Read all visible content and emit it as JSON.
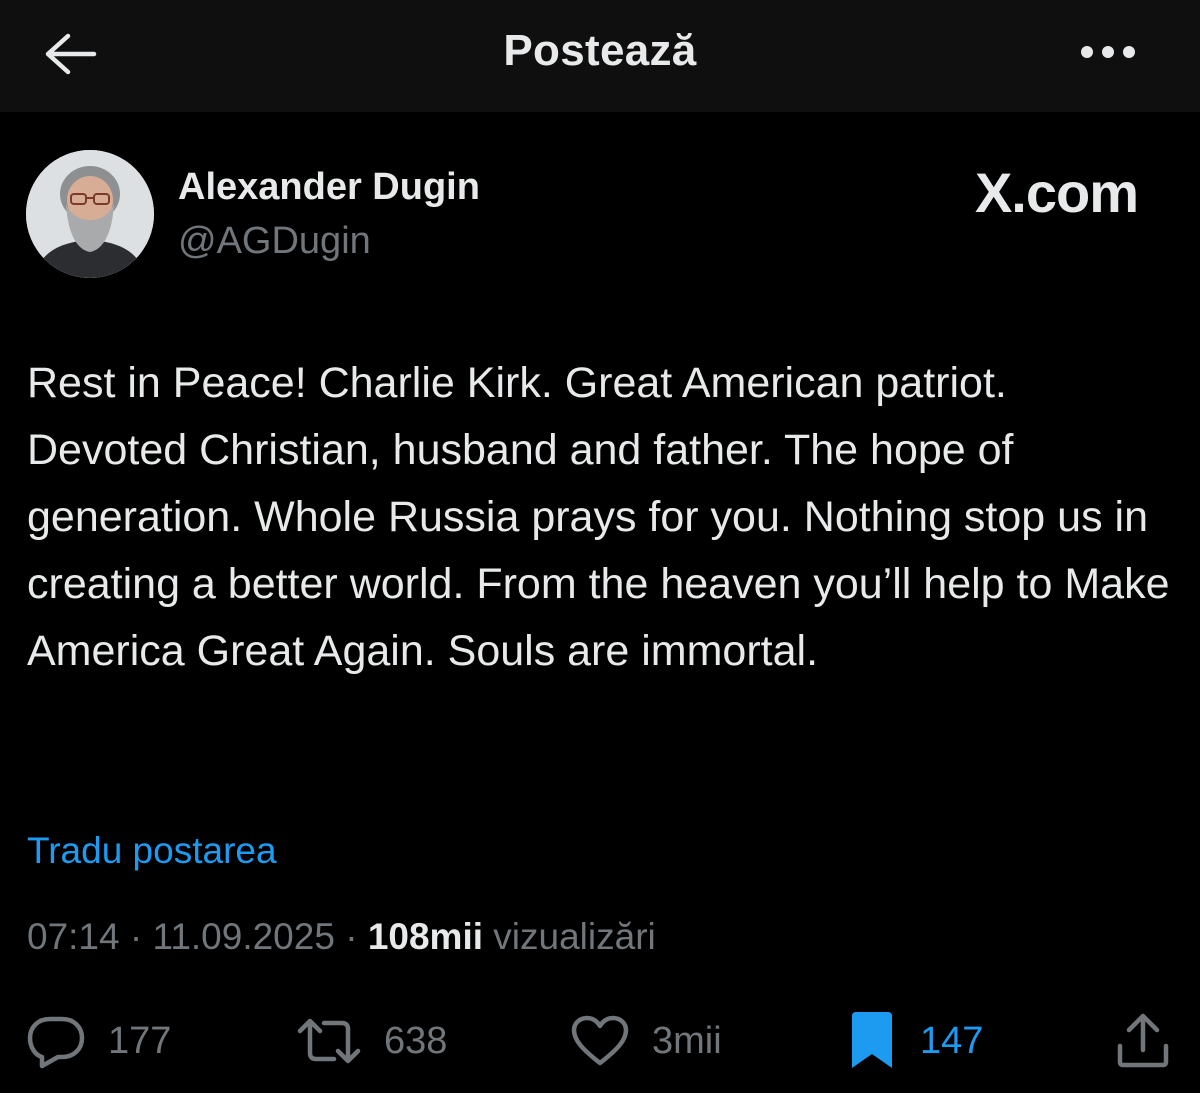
{
  "header": {
    "title": "Postează",
    "back_icon": "arrow-left-icon",
    "more_icon": "more-horizontal-icon"
  },
  "post": {
    "author": {
      "name": "Alexander Dugin",
      "handle": "@AGDugin"
    },
    "watermark": "X.com",
    "text": "Rest in Peace! Charlie Kirk. Great American patriot. Devoted Christian, husband and father. The hope of generation. Whole Russia prays for you. Nothing stop us in creating a better world. From the heaven you’ll help to Make America Great Again. Souls are immortal.",
    "translate_label": "Tradu postarea",
    "meta": {
      "time": "07:14",
      "separator": " · ",
      "date": "11.09.2025",
      "views_count": "108mii",
      "views_label": "vizualizări"
    },
    "actions": {
      "replies": "177",
      "reposts": "638",
      "likes": "3mii",
      "bookmarks": "147"
    }
  },
  "colors": {
    "background": "#000000",
    "header_background": "#0f0f0f",
    "text_primary": "#e7e9ea",
    "text_secondary": "#71767b",
    "accent": "#1d9bf0"
  }
}
